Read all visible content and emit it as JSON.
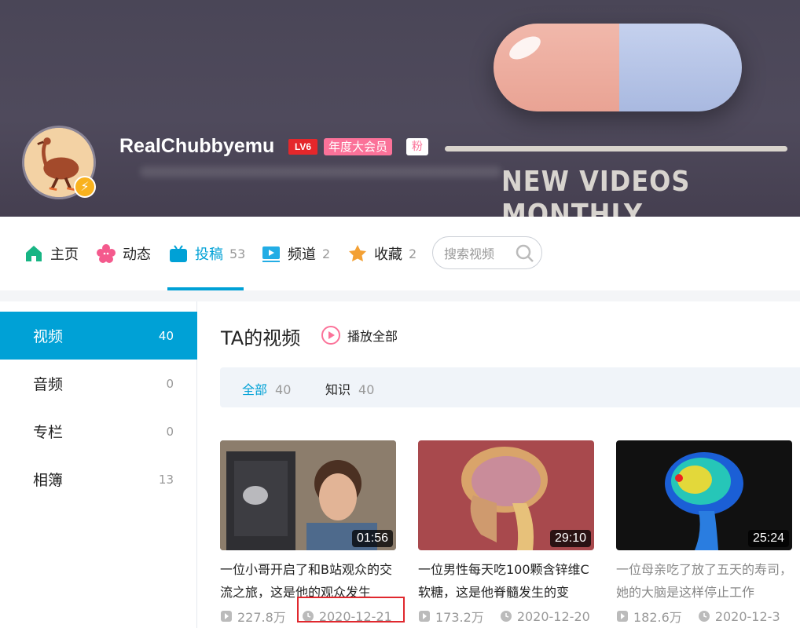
{
  "profile": {
    "username": "RealChubbyemu",
    "level_badge": "LV6",
    "vip_badge": "年度大会员",
    "fan_badge": "粉",
    "banner_text": "NEW VIDEOS MONTHLY"
  },
  "nav": {
    "tabs": [
      {
        "label": "主页",
        "count": ""
      },
      {
        "label": "动态",
        "count": ""
      },
      {
        "label": "投稿",
        "count": "53"
      },
      {
        "label": "频道",
        "count": "2"
      },
      {
        "label": "收藏",
        "count": "2"
      }
    ],
    "active_tab": "投稿",
    "search_placeholder": "搜索视频"
  },
  "sidebar": {
    "items": [
      {
        "label": "视频",
        "count": "40"
      },
      {
        "label": "音频",
        "count": "0"
      },
      {
        "label": "专栏",
        "count": "0"
      },
      {
        "label": "相簿",
        "count": "13"
      }
    ],
    "active": "视频"
  },
  "main": {
    "title": "TA的视频",
    "play_all": "播放全部",
    "filters": [
      {
        "label": "全部",
        "count": "40"
      },
      {
        "label": "知识",
        "count": "40"
      }
    ],
    "videos": [
      {
        "duration": "01:56",
        "title": "一位小哥开启了和B站观众的交流之旅，这是他的观众发生",
        "views": "227.8万",
        "date": "2020-12-21"
      },
      {
        "duration": "29:10",
        "title": "一位男性每天吃100颗含锌维C软糖，这是他脊髓发生的变",
        "views": "173.2万",
        "date": "2020-12-20"
      },
      {
        "duration": "25:24",
        "title": "一位母亲吃了放了五天的寿司，她的大脑是这样停止工作",
        "views": "182.6万",
        "date": "2020-12-3"
      }
    ]
  },
  "colors": {
    "accent": "#00a1d6",
    "pink": "#fb7299",
    "level_red": "#e5272b",
    "highlight": "#e0282e"
  },
  "icons": {
    "home": "home-icon",
    "dynamic": "flower-icon",
    "upload": "tv-icon",
    "channel": "play-box-icon",
    "favorite": "star-icon",
    "search": "search-icon",
    "play_all": "play-circle-icon",
    "views": "play-count-icon",
    "date": "clock-icon"
  }
}
